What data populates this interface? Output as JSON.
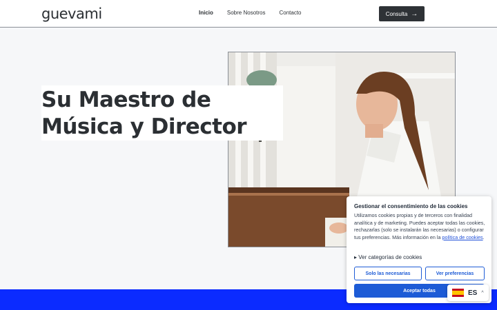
{
  "header": {
    "logo": "guevami",
    "nav": [
      "Inicio",
      "Sobre Nosotros",
      "Contacto"
    ],
    "cta_label": "Consulta",
    "cta_icon": "arrow-right-icon"
  },
  "hero": {
    "title": "Su Maestro de Música y Director",
    "photo_icon": "photo-woman-playing-piano"
  },
  "cookie": {
    "title": "Gestionar el consentimiento de las cookies",
    "body": "Utilizamos cookies propias y de terceros con finalidad analítica y de marketing. Puedes aceptar todas las cookies, rechazarlas (solo se instalarán las necesarias) o configurar tus preferencias. Más información en la",
    "policy_link": "política de cookies",
    "body_end": ".",
    "categories": "Ver categorías de cookies",
    "necessary_label": "Solo las necesarias",
    "prefs_label": "Ver preferencias",
    "accept_label": "Aceptar todas"
  },
  "language": {
    "code": "ES",
    "flag_icon": "spain-flag-icon"
  },
  "colors": {
    "accent_blue": "#1d5bd6",
    "band_blue": "#0b2bff",
    "dark_button": "#2e3236"
  }
}
